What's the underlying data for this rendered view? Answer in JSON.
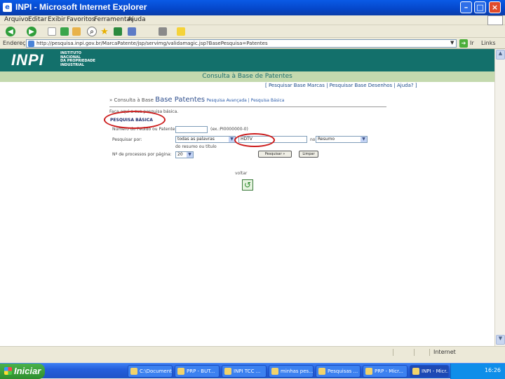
{
  "window": {
    "title": "INPI - Microsoft Internet Explorer"
  },
  "menu": [
    "Arquivo",
    "Editar",
    "Exibir",
    "Favoritos",
    "Ferramentas",
    "Ajuda"
  ],
  "address": {
    "label": "Endereço",
    "url": "http://pesquisa.inpi.gov.br/MarcaPatente/jsp/servimg/validamagic.jsp?BasePesquisa=Patentes",
    "links_label": "Links"
  },
  "banner": {
    "logo": "INPI",
    "institute": [
      "INSTITUTO",
      "NACIONAL",
      "DA PROPRIEDADE",
      "INDUSTRIAL"
    ]
  },
  "page": {
    "header": "Consulta à Base de Patentes",
    "top_links": "[ Pesquisar Base Marcas | Pesquisar Base Desenhos | Ajuda? ]",
    "section_prefix": "» Consulta à Base",
    "section_title": "Base Patentes",
    "section_sub": "Pesquisa Avançada | Pesquisa Básica",
    "hint": "Faça aqui a sua pesquisa básica.",
    "pesquisa_label": "PESQUISA BÁSICA",
    "row1_label": "Número do Pedido ou Patente:",
    "row1_hint": "(ex.:PI0000000-0)",
    "row2_label": "Pesquisar por:",
    "row2_select": "todas as palavras",
    "row2_sub": "do resumo ou título",
    "row2_value": "HDTV",
    "row2_connector": "no",
    "row2_select2": "Resumo",
    "row3_label": "Nº de processos por página:",
    "row3_select": "20",
    "btn_search": "Pesquisar »",
    "btn_clear": "Limpar",
    "voltar": "voltar"
  },
  "status": {
    "zone": "Internet"
  },
  "taskbar": {
    "start": "Iniciar",
    "tasks": [
      "C:\\Documents...",
      "PRP - BUT...",
      "INPI TCC ...",
      "minhas pes...",
      "Pesquisas ...",
      "PRP - Micr...",
      "INPI - Micr..."
    ],
    "clock": "16:26"
  },
  "colors": {
    "banner": "#13706b",
    "annotation": "#cc1b1b",
    "accent": "#c4d9ae"
  }
}
